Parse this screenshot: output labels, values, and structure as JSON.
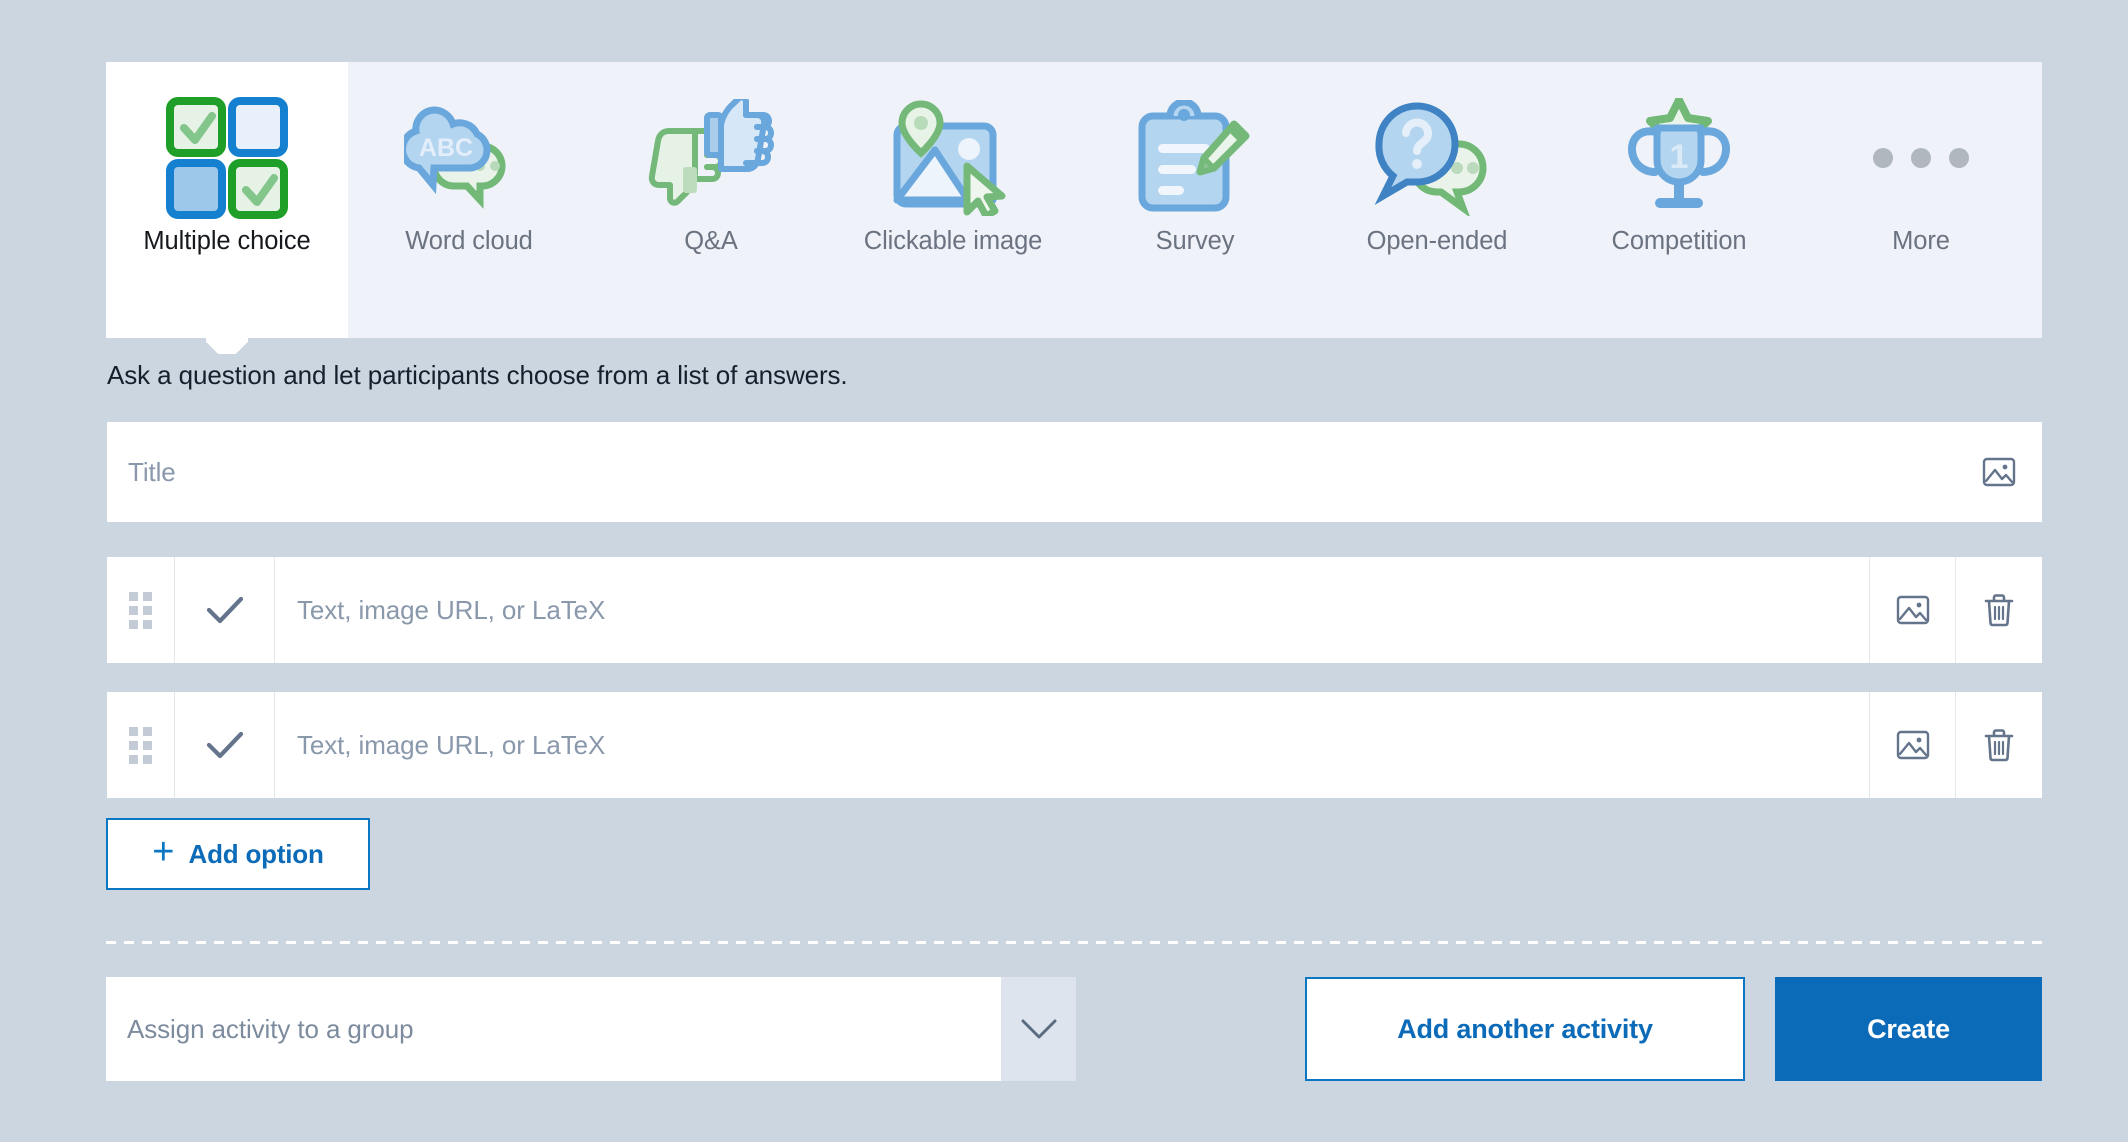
{
  "background_color": "#ccd6e0",
  "accent_color": "#0b6bb8",
  "tabs": [
    {
      "label": "Multiple choice",
      "icon": "four-checkboxes-icon",
      "selected": true
    },
    {
      "label": "Word cloud",
      "icon": "speech-bubbles-abc-icon",
      "selected": false
    },
    {
      "label": "Q&A",
      "icon": "thumbs-up-down-icon",
      "selected": false
    },
    {
      "label": "Clickable image",
      "icon": "image-pin-cursor-icon",
      "selected": false
    },
    {
      "label": "Survey",
      "icon": "clipboard-pencil-icon",
      "selected": false
    },
    {
      "label": "Open-ended",
      "icon": "question-speech-bubbles-icon",
      "selected": false
    },
    {
      "label": "Competition",
      "icon": "trophy-star-icon",
      "selected": false
    },
    {
      "label": "More",
      "icon": "ellipsis-icon",
      "selected": false
    }
  ],
  "description": "Ask a question and let participants choose from a list of answers.",
  "title_field": {
    "placeholder": "Title",
    "value": "",
    "image_icon": "image-icon"
  },
  "options": [
    {
      "drag_handle_icon": "drag-handle-icon",
      "check_icon": "check-icon",
      "placeholder": "Text, image URL, or LaTeX",
      "value": "",
      "image_icon": "image-icon",
      "delete_icon": "trash-icon"
    },
    {
      "drag_handle_icon": "drag-handle-icon",
      "check_icon": "check-icon",
      "placeholder": "Text, image URL, or LaTeX",
      "value": "",
      "image_icon": "image-icon",
      "delete_icon": "trash-icon"
    }
  ],
  "add_option": {
    "label": "Add option",
    "icon": "plus-icon"
  },
  "footer": {
    "group_select": {
      "placeholder": "Assign activity to a group",
      "value": "",
      "icon": "chevron-down-icon"
    },
    "secondary_button": "Add another activity",
    "primary_button": "Create"
  },
  "word_cloud_icon_text": "ABC",
  "competition_icon_text": "1"
}
